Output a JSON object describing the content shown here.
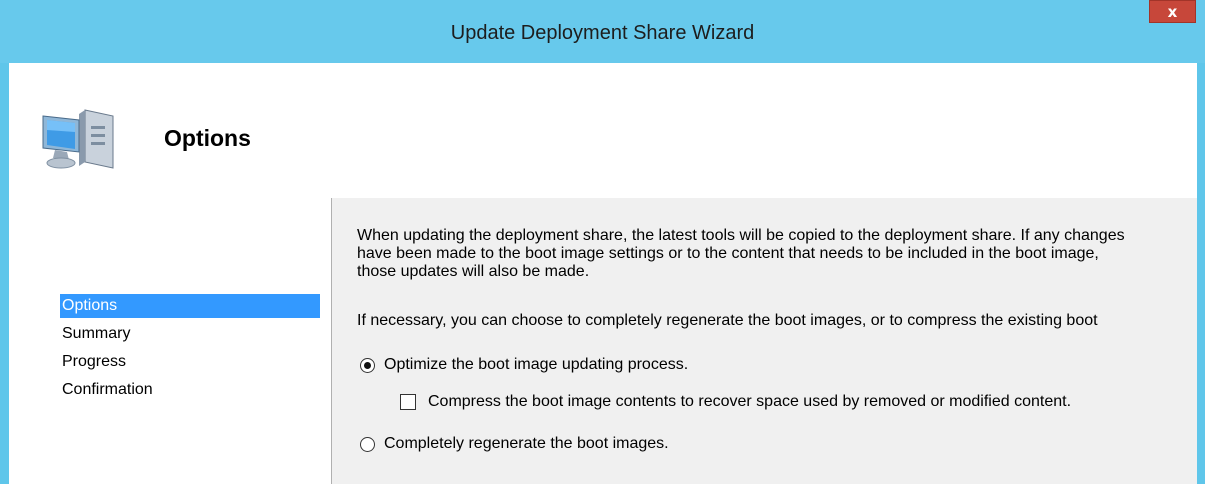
{
  "window": {
    "title": "Update Deployment Share Wizard",
    "close_label": "x"
  },
  "header": {
    "title": "Options",
    "icon": "computer-icon"
  },
  "nav": {
    "items": [
      {
        "label": "Options",
        "selected": true
      },
      {
        "label": "Summary",
        "selected": false
      },
      {
        "label": "Progress",
        "selected": false
      },
      {
        "label": "Confirmation",
        "selected": false
      }
    ]
  },
  "content": {
    "intro_line1": "When updating the deployment share, the latest tools will be copied to the deployment share.  If any changes",
    "intro_line2": "have been made to the boot image settings or to the content that needs to be included in the boot image,",
    "intro_line3": "those updates will also be made.",
    "choice_text": "If necessary, you can choose to completely regenerate the boot images, or to compress the existing boot",
    "option_optimize": "Optimize the boot image updating process.",
    "option_compress": "Compress the boot image contents to recover space used by removed or modified content.",
    "option_regenerate": "Completely regenerate the boot images.",
    "optimize_selected": true,
    "compress_checked": false,
    "regenerate_selected": false
  }
}
